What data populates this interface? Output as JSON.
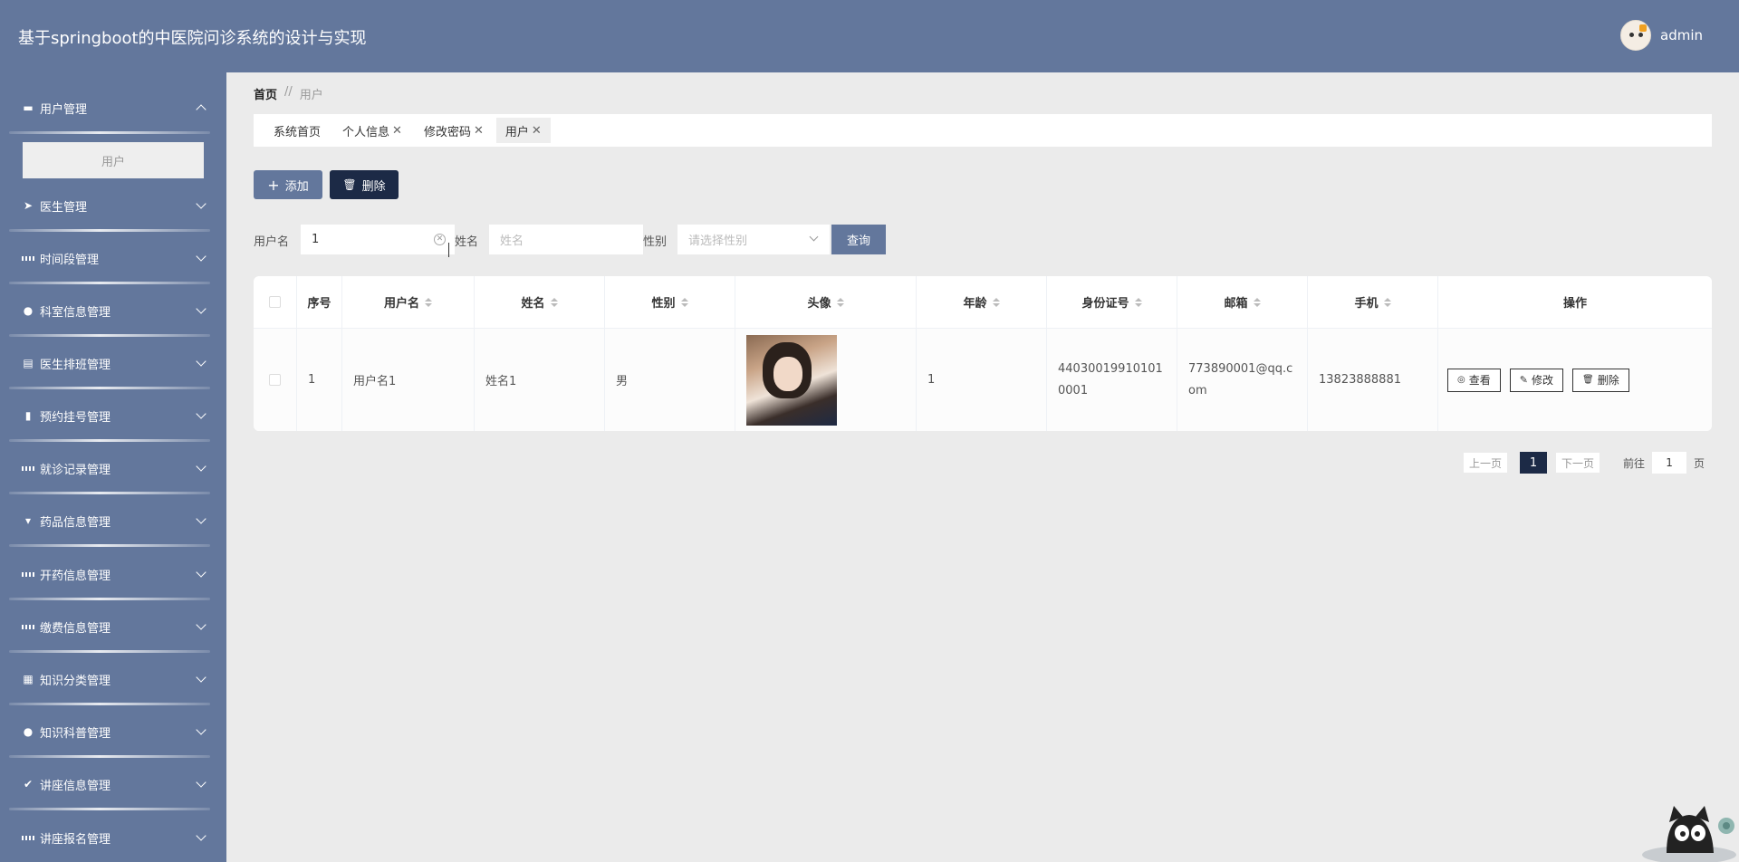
{
  "header": {
    "title": "基于springboot的中医院问诊系统的设计与实现",
    "username": "admin"
  },
  "sidebar": {
    "items": [
      {
        "label": "用户管理",
        "icon": "chat-icon",
        "expanded": true,
        "sub": [
          "用户"
        ]
      },
      {
        "label": "医生管理",
        "icon": "send-icon"
      },
      {
        "label": "时间段管理",
        "icon": "grid-icon"
      },
      {
        "label": "科室信息管理",
        "icon": "user-icon"
      },
      {
        "label": "医生排班管理",
        "icon": "chart-icon"
      },
      {
        "label": "预约挂号管理",
        "icon": "bar-chart-icon"
      },
      {
        "label": "就诊记录管理",
        "icon": "grid-icon"
      },
      {
        "label": "药品信息管理",
        "icon": "stamp-icon"
      },
      {
        "label": "开药信息管理",
        "icon": "grid-icon"
      },
      {
        "label": "缴费信息管理",
        "icon": "grid-icon"
      },
      {
        "label": "知识分类管理",
        "icon": "table-icon"
      },
      {
        "label": "知识科普管理",
        "icon": "user-icon"
      },
      {
        "label": "讲座信息管理",
        "icon": "clipboard-icon"
      },
      {
        "label": "讲座报名管理",
        "icon": "grid-icon"
      }
    ]
  },
  "breadcrumb": {
    "home": "首页",
    "sep": "//",
    "current": "用户"
  },
  "tabs": [
    {
      "label": "系统首页",
      "closable": false
    },
    {
      "label": "个人信息",
      "closable": true
    },
    {
      "label": "修改密码",
      "closable": true
    },
    {
      "label": "用户",
      "closable": true,
      "active": true
    }
  ],
  "actions": {
    "add": "添加",
    "delete": "删除"
  },
  "search": {
    "username_label": "用户名",
    "username_value": "1",
    "name_label": "姓名",
    "name_placeholder": "姓名",
    "gender_label": "性别",
    "gender_placeholder": "请选择性别",
    "query": "查询"
  },
  "table": {
    "columns": [
      "序号",
      "用户名",
      "姓名",
      "性别",
      "头像",
      "年龄",
      "身份证号",
      "邮箱",
      "手机",
      "操作"
    ],
    "rows": [
      {
        "index": "1",
        "username": "用户名1",
        "name": "姓名1",
        "gender": "男",
        "age": "1",
        "id_line1": "44030019910101",
        "id_line2": "0001",
        "email_line1": "773890001@qq.c",
        "email_line2": "om",
        "phone": "13823888881"
      }
    ],
    "row_actions": {
      "view": "查看",
      "edit": "修改",
      "delete": "删除"
    }
  },
  "pagination": {
    "prev": "上一页",
    "current": "1",
    "next": "下一页",
    "goto": "前往",
    "goto_value": "1",
    "page_unit": "页"
  },
  "colors": {
    "primary": "#63779c",
    "dark": "#1c2a46",
    "background": "#ebebeb"
  }
}
